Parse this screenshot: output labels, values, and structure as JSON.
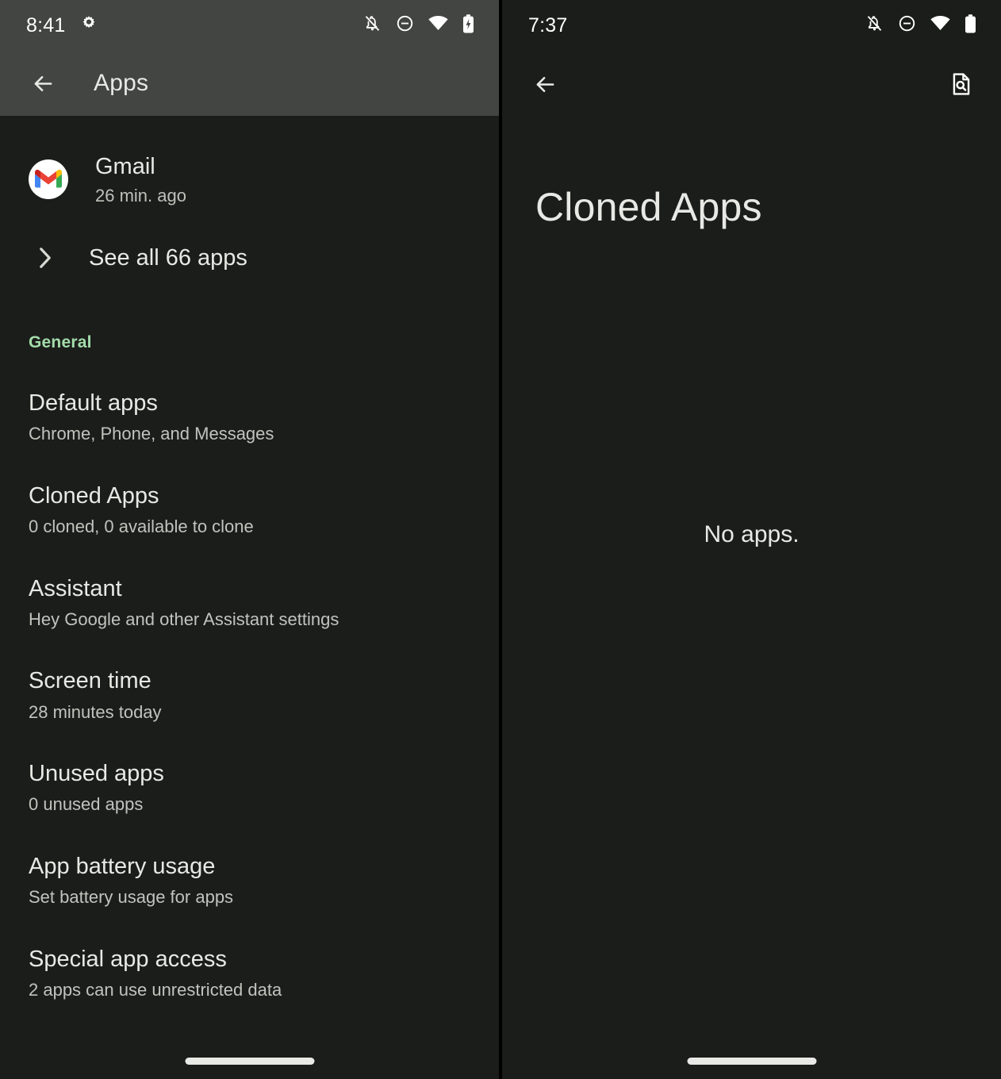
{
  "left_panel": {
    "status_bar": {
      "time": "8:41",
      "icons": [
        "gear-icon",
        "notifications-off-icon",
        "do-not-disturb-icon",
        "wifi-icon",
        "battery-charging-icon"
      ]
    },
    "appbar": {
      "back_label": "Back",
      "title": "Apps"
    },
    "recent_app": {
      "icon": "gmail-icon",
      "name": "Gmail",
      "subtitle": "26 min. ago"
    },
    "see_all": {
      "icon": "chevron-right-icon",
      "label": "See all 66 apps"
    },
    "section_general": "General",
    "settings": [
      {
        "title": "Default apps",
        "subtitle": "Chrome, Phone, and Messages"
      },
      {
        "title": "Cloned Apps",
        "subtitle": "0 cloned, 0 available to clone"
      },
      {
        "title": "Assistant",
        "subtitle": "Hey Google and other Assistant settings"
      },
      {
        "title": "Screen time",
        "subtitle": "28 minutes today"
      },
      {
        "title": "Unused apps",
        "subtitle": "0 unused apps"
      },
      {
        "title": "App battery usage",
        "subtitle": "Set battery usage for apps"
      },
      {
        "title": "Special app access",
        "subtitle": "2 apps can use unrestricted data"
      }
    ]
  },
  "right_panel": {
    "status_bar": {
      "time": "7:37",
      "icons": [
        "notifications-off-icon",
        "do-not-disturb-icon",
        "wifi-icon",
        "battery-full-icon"
      ]
    },
    "appbar": {
      "back_label": "Back",
      "search_label": "Search in page"
    },
    "title": "Cloned Apps",
    "empty_message": "No apps."
  },
  "colors": {
    "background": "#1b1d1a",
    "appbar_left": "#434542",
    "text_primary": "#e8e9e4",
    "text_secondary": "#bfc4bd",
    "accent_green": "#a3dcab",
    "divider": "#000000"
  }
}
